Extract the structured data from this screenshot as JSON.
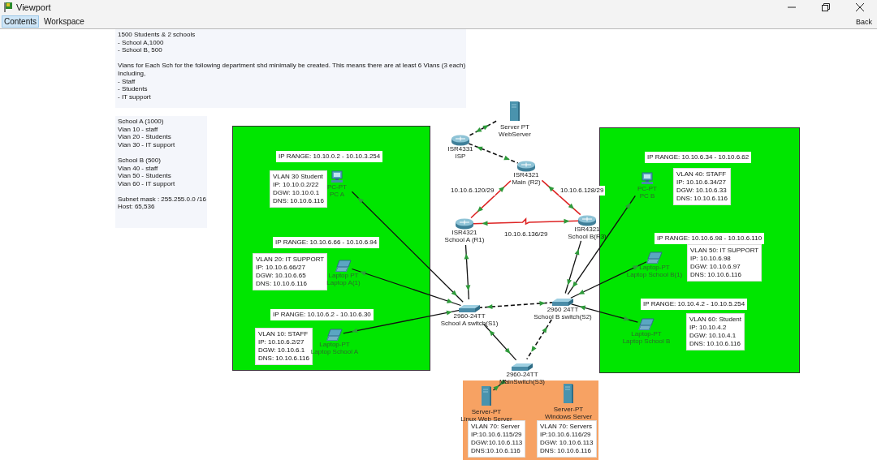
{
  "window": {
    "title": "Viewport",
    "back": "Back"
  },
  "tabs": [
    {
      "label": "Contents",
      "selected": true
    },
    {
      "label": "Workspace",
      "selected": false
    }
  ],
  "notes": [
    {
      "paragraphs": [
        [
          "1500 Students & 2 schools",
          "- School A,1000",
          "- School B, 500"
        ],
        [
          "Vlans for Each Sch for the following department shd minimally be created.  This means there are at least 6 Vlans (3 each)",
          "Including,",
          "- Staff",
          "- Students",
          "- IT support"
        ]
      ]
    },
    {
      "paragraphs": [
        [
          "School A  (1000)",
          "Vlan 10 - staff",
          "Vlan 20 - Students",
          "Vlan 30 - IT support"
        ],
        [
          "School B (500)",
          "Vlan 40 - staff",
          "Vlan 50 - Students",
          "Vlan 60 - IT support"
        ],
        [
          "Subnet mask : 255.255.0.0 /16",
          "Host: 65,536"
        ]
      ]
    }
  ],
  "zones": [
    {
      "color": "#00e600"
    },
    {
      "color": "#00e600"
    },
    {
      "color": "#f7a263"
    }
  ],
  "range_labels": [
    "IP RANGE: 10.10.0.2 - 10.10.3.254",
    "IP RANGE: 10.10.6.66 - 10.10.6.94",
    "IP RANGE: 10.10.6.2 - 10.10.6.30",
    "IP RANGE: 10.10.6.34 - 10.10.6.62",
    "IP RANGE: 10.10.6.98 - 10.10.6.110",
    "IP RANGE: 10.10.4.2 - 10.10.5.254"
  ],
  "info_boxes": [
    {
      "lines": [
        "VLAN 30 Student",
        "IP: 10.10.0.2/22",
        "DGW: 10.10.0.1",
        "DNS: 10.10.6.116"
      ]
    },
    {
      "lines": [
        "VLAN 20: IT SUPPORT",
        "IP: 10.10.6.66/27",
        "DGW: 10.10.6.65",
        "DNS: 10.10.6.116"
      ]
    },
    {
      "lines": [
        "VLAN 10: STAFF",
        "IP: 10.10.6.2/27",
        "DGW: 10.10.6.1",
        "DNS: 10.10.6.116"
      ]
    },
    {
      "lines": [
        "VLAN 40: STAFF",
        "IP: 10.10.6.34/27",
        "DGW: 10.10.6.33",
        "DNS: 10.10.6.116"
      ]
    },
    {
      "lines": [
        "VLAN 50: IT SUPPORT",
        "IP: 10.10.6.98",
        "DGW: 10.10.6.97",
        "DNS: 10.10.6.116"
      ]
    },
    {
      "lines": [
        "VLAN 60: Student",
        "IP: 10.10.4.2",
        "DGW: 10.10.4.1",
        "DNS: 10.10.6.116"
      ]
    },
    {
      "lines": [
        "VLAN 70: Server",
        "IP:10.10.6.115/29",
        "DGW:10.10.6.113",
        "DNS:10.10.6.116"
      ]
    },
    {
      "lines": [
        "VLAN 70: Servers",
        "IP:10.10.6.116/29",
        "DGW: 10.10.6.113",
        "DNS: 10.10.6.116"
      ]
    }
  ],
  "subnet_labels": [
    "10.10.6.120/29",
    "10.10.6.128/29",
    "10.10.6.136/29"
  ],
  "devices": [
    {
      "kind": "server",
      "model": "Server PT",
      "name": "WebServer"
    },
    {
      "kind": "router",
      "model": "ISR4331",
      "name": "ISP"
    },
    {
      "kind": "router",
      "model": "ISR4321",
      "name": "Main (R2)"
    },
    {
      "kind": "router",
      "model": "ISR4321",
      "name": "School A (R1)"
    },
    {
      "kind": "router",
      "model": "ISR4321",
      "name": "School B(R3)"
    },
    {
      "kind": "pc",
      "model": "PC-PT",
      "name": "PC A"
    },
    {
      "kind": "pc",
      "model": "PC-PT",
      "name": "PC B"
    },
    {
      "kind": "laptop",
      "model": "Laptop PT",
      "name": "Laptop A(1)"
    },
    {
      "kind": "laptop",
      "model": "Laptop-PT",
      "name": "Laptop School B(1)"
    },
    {
      "kind": "switch",
      "model": "2960-24TT",
      "name": "School A switch(S1)"
    },
    {
      "kind": "switch",
      "model": "2960 24TT",
      "name": "School B switch(S2)"
    },
    {
      "kind": "laptop",
      "model": "Laptop-PT",
      "name": "Laptop School A"
    },
    {
      "kind": "laptop",
      "model": "Laptop-PT",
      "name": "Laptop School B"
    },
    {
      "kind": "switch",
      "model": "2960-24TT",
      "name": "MainSwitch(S3)"
    },
    {
      "kind": "server",
      "model": "Server-PT",
      "name": "Linux Web Server"
    },
    {
      "kind": "server",
      "model": "Server-PT",
      "name": "Windows Server"
    }
  ]
}
